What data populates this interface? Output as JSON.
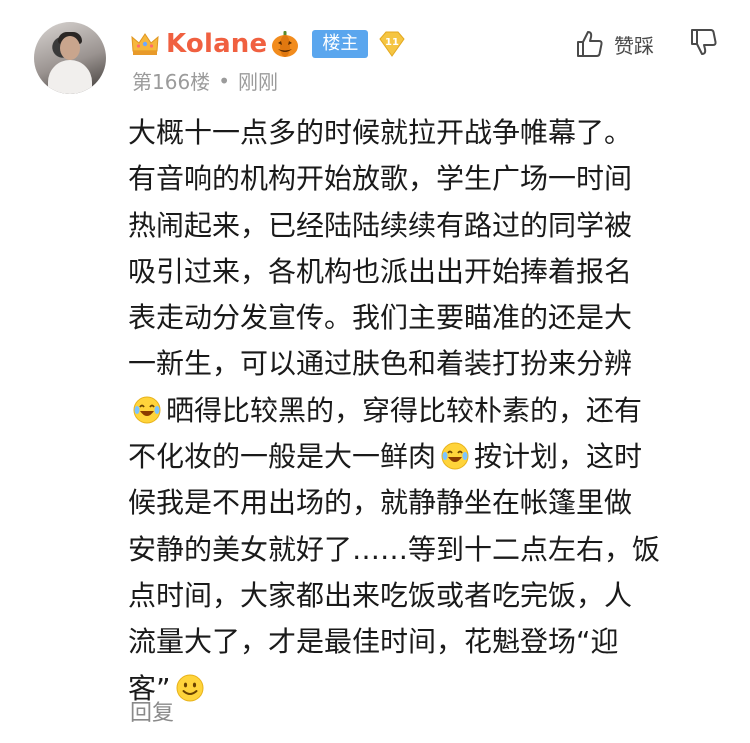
{
  "post": {
    "username": "Kolane",
    "badge_owner": "楼主",
    "level": "11",
    "floor": "第166楼",
    "separator": "•",
    "time": "刚刚",
    "like_label": "赞踩",
    "reply_label": "回复",
    "icons": {
      "crown": "crown-icon",
      "pumpkin": "pumpkin-icon",
      "level": "level-diamond-icon",
      "thumb_up": "thumb-up-icon",
      "thumb_down": "thumb-down-icon",
      "emoji_laugh_cry": "laugh-cry-emoji-icon",
      "emoji_smile": "smile-emoji-icon"
    },
    "content_lines": [
      "大概十一点多的时候就拉开战争帷幕了。",
      "有音响的机构开始放歌，学生广场一时间",
      "热闹起来，已经陆陆续续有路过的同学被",
      "吸引过来，各机构也派出出开始捧着报名",
      "表走动分发宣传。我们主要瞄准的还是大",
      "一新生，可以通过肤色和着装打扮来分辨",
      "晒得比较黑的，穿得比较朴素的，还有",
      "不化妆的一般是大一鲜肉",
      "按计划，这时",
      "候我是不用出场的，就静静坐在帐篷里做",
      "安静的美女就好了……等到十二点左右，饭",
      "点时间，大家都出来吃饭或者吃完饭，人",
      "流量大了，才是最佳时间，花魁登场“迎",
      "客”"
    ]
  },
  "colors": {
    "username": "#f06040",
    "owner_badge_bg": "#5aa6ee",
    "meta_text": "#9b9b9b",
    "body_text": "#1a1a1a"
  }
}
